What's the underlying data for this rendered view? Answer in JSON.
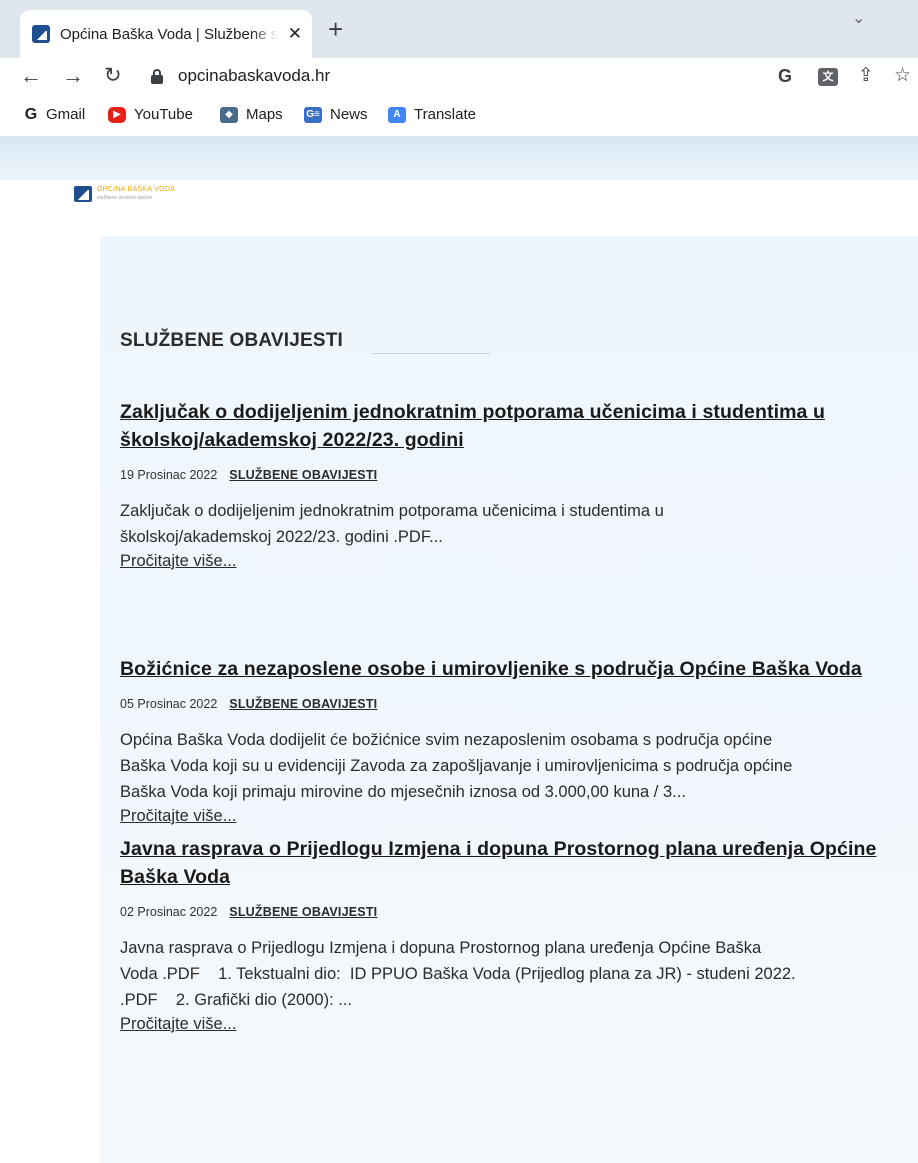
{
  "browser": {
    "tab_title": "Općina Baška Voda | Službene s",
    "tab_close": "✕",
    "new_tab": "+",
    "tab_search": "⌄",
    "url": "opcinabaskavoda.hr",
    "toolbar_icons": [
      "google-icon",
      "translate-icon",
      "share-icon",
      "star-icon"
    ]
  },
  "bookmarks": [
    {
      "label": "Gmail",
      "icon": "G"
    },
    {
      "label": "YouTube",
      "icon": "▶"
    },
    {
      "label": "Maps",
      "icon": "◆"
    },
    {
      "label": "News",
      "icon": "G≡"
    },
    {
      "label": "Translate",
      "icon": "A"
    }
  ],
  "site": {
    "logo_line1": "OPĆINA BAŠKA VODA",
    "logo_line2": "službene stranice općine"
  },
  "section": {
    "title": "SLUŽBENE OBAVIJESTI"
  },
  "articles": [
    {
      "title": "Zaključak o dodijeljenim jednokratnim potporama učenicima i studentima u školskoj/akademskoj 2022/23. godini",
      "date": "19 Prosinac 2022",
      "category": "SLUŽBENE OBAVIJESTI",
      "excerpt": "Zaključak o dodijeljenim jednokratnim potporama učenicima i studentima u\nškolskoj/akademskoj 2022/23. godini .PDF...",
      "more": "Pročitajte više..."
    },
    {
      "title": "Božićnice za nezaposlene osobe i umirovljenike s područja Općine Baška Voda",
      "date": "05 Prosinac 2022",
      "category": "SLUŽBENE OBAVIJESTI",
      "excerpt": "Općina Baška Voda dodijelit će božićnice svim nezaposlenim osobama s područja općine\nBaška Voda koji su u evidenciji Zavoda za zapošljavanje i umirovljenicima s područja općine\nBaška Voda koji primaju mirovine do mjesečnih iznosa od 3.000,00 kuna / 3...",
      "more": "Pročitajte više..."
    },
    {
      "title": "Javna rasprava o Prijedlogu Izmjena i dopuna Prostornog plana uređenja Općine Baška Voda",
      "date": "02 Prosinac 2022",
      "category": "SLUŽBENE OBAVIJESTI",
      "excerpt": "Javna rasprava o Prijedlogu Izmjena i dopuna Prostornog plana uređenja Općine Baška\nVoda .PDF    1. Tekstualni dio:  ID PPUO Baška Voda (Prijedlog plana za JR) - studeni 2022.\n.PDF    2. Grafički dio (2000): ...",
      "more": "Pročitajte više..."
    }
  ]
}
